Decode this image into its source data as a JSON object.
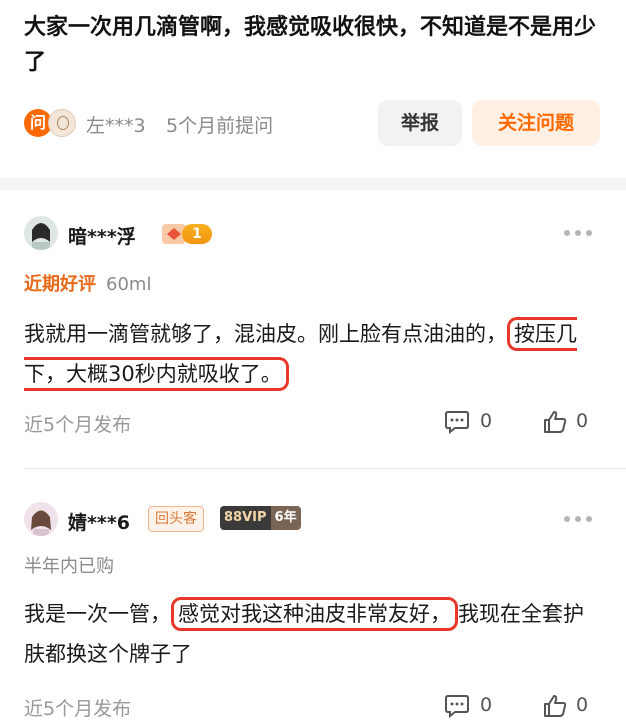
{
  "question": {
    "text": "大家一次用几滴管啊，我感觉吸收很快，不知道是不是用少了",
    "ask_icon_label": "问",
    "asker_name": "左***3",
    "asked_time": "5个月前提问",
    "report_label": "举报",
    "follow_label": "关注问题"
  },
  "reviews": [
    {
      "user": "暗***浮",
      "level": "1",
      "tag": "近期好评",
      "spec": "60ml",
      "content_before": "我就用一滴管就够了，混油皮。刚上脸有点油油的，",
      "content_highlight": "按压几下，大概30秒内就吸收了。",
      "content_after": "",
      "time": "近5个月发布",
      "comments": "0",
      "likes": "0"
    },
    {
      "user": "婧***6",
      "badge_return": "回头客",
      "badge_vip": "88VIP",
      "badge_years": "6年",
      "tag": "半年内已购",
      "content_before": "我是一次一管，",
      "content_highlight": "感觉对我这种油皮非常友好，",
      "content_after": "我现在全套护肤都换这个牌子了",
      "time": "近5个月发布",
      "comments": "0",
      "likes": "0"
    }
  ],
  "colors": {
    "accent": "#ff6a00",
    "highlight_border": "#e8382c",
    "muted": "#8a8a8a"
  },
  "icons": [
    "ask-icon",
    "more-icon",
    "comment-icon",
    "like-icon",
    "crown-icon"
  ]
}
